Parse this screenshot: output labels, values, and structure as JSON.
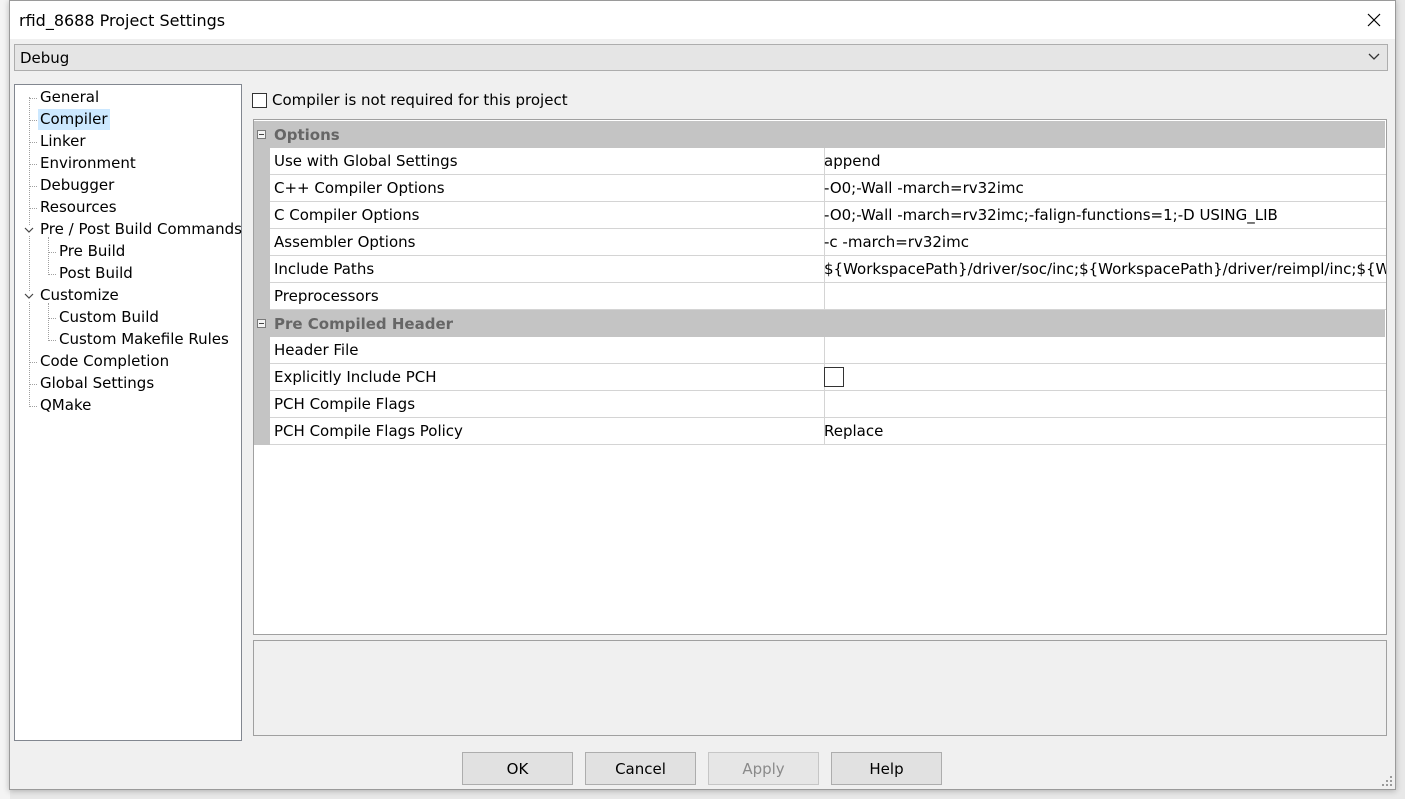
{
  "window": {
    "title": "rfid_8688 Project Settings"
  },
  "configuration": {
    "selected": "Debug"
  },
  "tree": {
    "items": [
      {
        "label": "General"
      },
      {
        "label": "Compiler",
        "selected": true
      },
      {
        "label": "Linker"
      },
      {
        "label": "Environment"
      },
      {
        "label": "Debugger"
      },
      {
        "label": "Resources"
      },
      {
        "label": "Pre / Post Build Commands",
        "expanded": true
      },
      {
        "label": "Pre Build"
      },
      {
        "label": "Post Build"
      },
      {
        "label": "Customize",
        "expanded": true
      },
      {
        "label": "Custom Build"
      },
      {
        "label": "Custom Makefile Rules"
      },
      {
        "label": "Code Completion"
      },
      {
        "label": "Global Settings"
      },
      {
        "label": "QMake"
      }
    ]
  },
  "compiler_not_required": {
    "label": "Compiler is not required for this project",
    "checked": false
  },
  "grid": {
    "categories": [
      {
        "label": "Options",
        "rows": [
          {
            "name": "Use with Global Settings",
            "value": "append"
          },
          {
            "name": "C++ Compiler Options",
            "value": "-O0;-Wall -march=rv32imc"
          },
          {
            "name": "C Compiler Options",
            "value": "-O0;-Wall -march=rv32imc;-falign-functions=1;-D USING_LIB"
          },
          {
            "name": "Assembler Options",
            "value": "-c  -march=rv32imc"
          },
          {
            "name": "Include Paths",
            "value": "${WorkspacePath}/driver/soc/inc;${WorkspacePath}/driver/reimpl/inc;${WorkspacePath}/driver/inc"
          },
          {
            "name": "Preprocessors",
            "value": ""
          }
        ]
      },
      {
        "label": "Pre Compiled Header",
        "rows": [
          {
            "name": "Header File",
            "value": ""
          },
          {
            "name": "Explicitly Include PCH",
            "value": "",
            "checkbox": true,
            "checked": false
          },
          {
            "name": "PCH Compile Flags",
            "value": ""
          },
          {
            "name": "PCH Compile Flags Policy",
            "value": "Replace"
          }
        ]
      }
    ]
  },
  "description": "",
  "buttons": {
    "ok": "OK",
    "cancel": "Cancel",
    "apply": "Apply",
    "help": "Help"
  }
}
